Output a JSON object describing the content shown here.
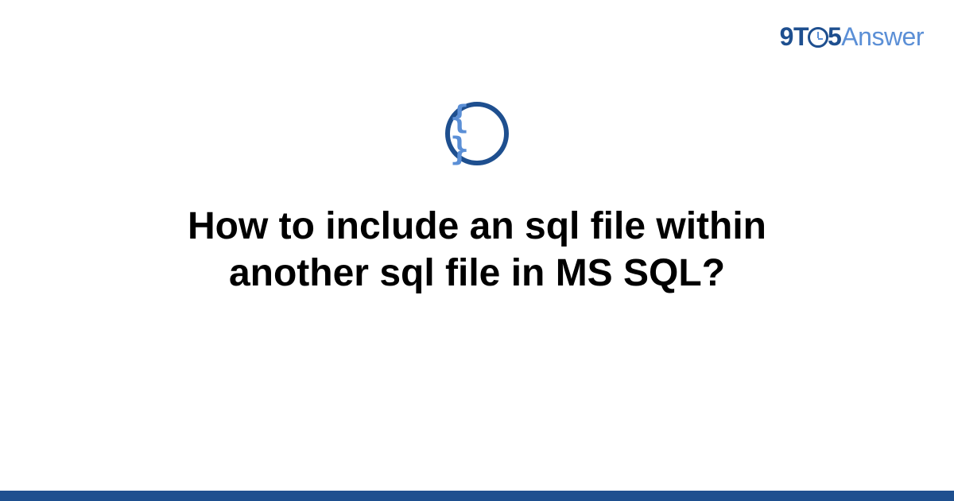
{
  "logo": {
    "part_nine": "9",
    "part_t": "T",
    "part_five": "5",
    "part_answer": "Answer"
  },
  "icon": {
    "braces": "{ }",
    "name": "code-braces-icon"
  },
  "title": "How to include an sql file within another sql file in MS SQL?",
  "colors": {
    "primary": "#1e4f8f",
    "secondary": "#5b8fd6",
    "background": "#ffffff"
  }
}
